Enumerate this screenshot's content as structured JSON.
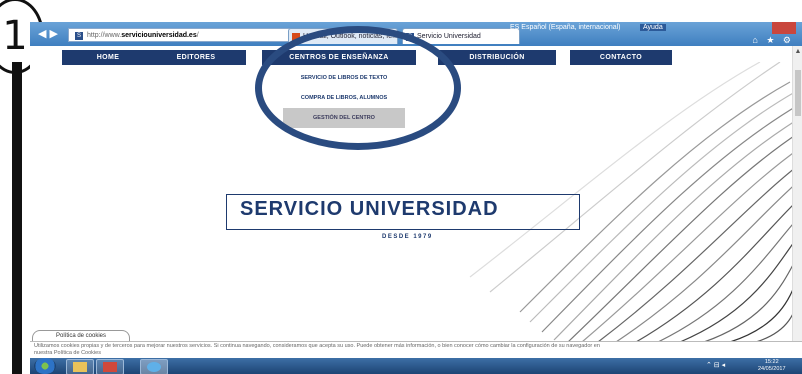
{
  "annotation": {
    "step_number": "1"
  },
  "browser": {
    "address_prefix": "http://www.",
    "address_domain": "serviciouniversidad.es",
    "address_suffix": "/",
    "tabs": [
      "Hotmail, Outlook, noticias, fe...",
      "Servicio Universidad"
    ],
    "language": "ES Español (España, internacional)",
    "help": "Ayuda"
  },
  "menu": {
    "items": [
      "HOME",
      "EDITORES",
      "CENTROS DE ENSEÑANZA",
      "DISTRIBUCIÓN",
      "CONTACTO"
    ],
    "dropdown": [
      "SERVICIO DE LIBROS DE TEXTO",
      "COMPRA DE LIBROS, ALUMNOS",
      "GESTIÓN DEL CENTRO"
    ]
  },
  "hero": {
    "title": "SERVICIO UNIVERSIDAD",
    "subtitle": "DESDE 1979"
  },
  "cookies": {
    "tab_label": "Política de cookies",
    "text": "Utilizamos cookies propias y de terceros para mejorar nuestros servicios. Si continua navegando, consideramos que acepta su uso. Puede obtener más información, o bien conocer cómo cambiar la configuración de su navegador en",
    "link": "nuestra Política de Cookies"
  },
  "taskbar": {
    "time": "15:22",
    "date": "24/05/2017"
  },
  "colors": {
    "brand_navy": "#1e3a6e",
    "annotation_ring": "#2a4b80"
  }
}
